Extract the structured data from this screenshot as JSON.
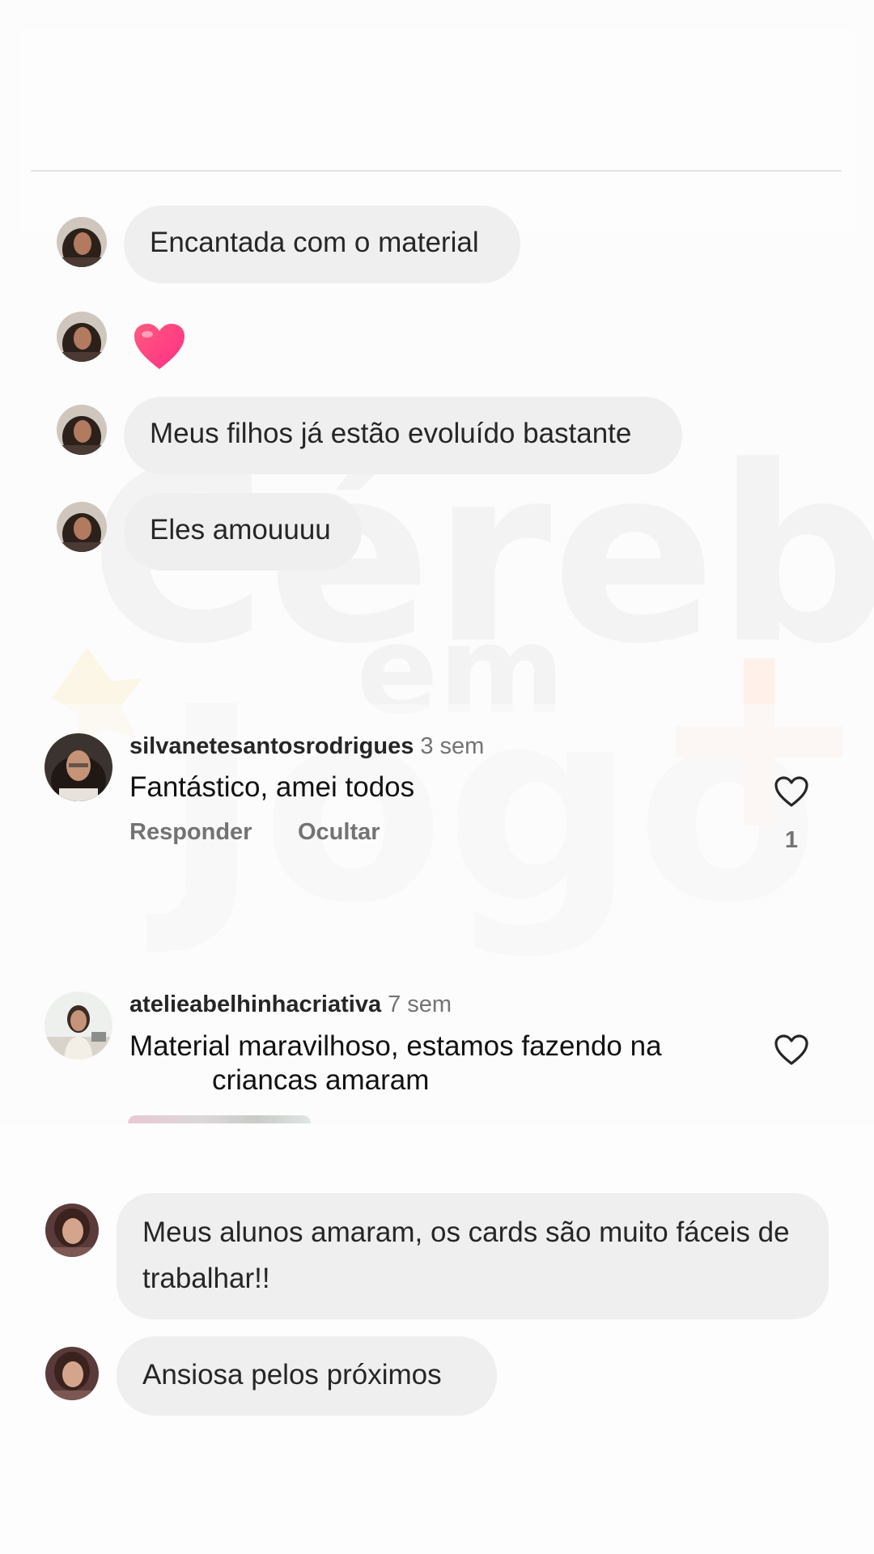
{
  "chat_messages_top": [
    {
      "text": "Encantada com o material"
    },
    {
      "emoji": "heart"
    },
    {
      "text": "Meus filhos já estão evoluído bastante"
    },
    {
      "text": "Eles amouuuu"
    }
  ],
  "watermark": {
    "word1": "Cérebro",
    "word2": "em",
    "word3": "Jogo",
    "plus": "+"
  },
  "comments": [
    {
      "username": "silvanetesantosrodrigues",
      "time": "3 sem",
      "text": "Fantástico, amei todos",
      "reply_label": "Responder",
      "hide_label": "Ocultar",
      "like_count": "1"
    },
    {
      "username": "atelieabelhinhacriativa",
      "time": "7 sem",
      "text_line1": "Material maravilhoso,  estamos fazendo na",
      "text_line2": "criancas amaram"
    }
  ],
  "chat_messages_bottom": [
    {
      "text": "Meus alunos amaram, os cards são muito fáceis de trabalhar!!"
    },
    {
      "text": "Ansiosa pelos próximos"
    }
  ],
  "colors": {
    "bubble": "#eeeeee",
    "text": "#262626",
    "muted": "#737373",
    "heart": "#ff3d77"
  }
}
